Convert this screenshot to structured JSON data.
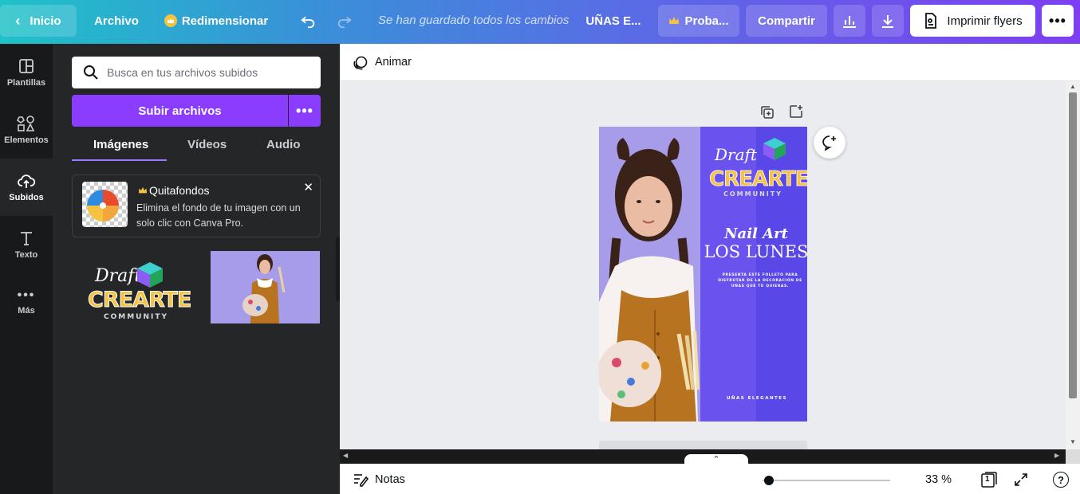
{
  "topbar": {
    "home_label": "Inicio",
    "file_label": "Archivo",
    "resize_label": "Redimensionar",
    "save_status": "Se han guardado todos los cambios",
    "doc_title": "UÑAS E...",
    "trial_label": "Proba...",
    "share_label": "Compartir",
    "print_label": "Imprimir flyers",
    "crown_color": "#f5c242"
  },
  "rail": {
    "items": [
      {
        "label": "Plantillas",
        "icon": "layout-icon"
      },
      {
        "label": "Elementos",
        "icon": "shapes-icon"
      },
      {
        "label": "Subidos",
        "icon": "cloud-upload-icon"
      },
      {
        "label": "Texto",
        "icon": "text-icon"
      },
      {
        "label": "Más",
        "icon": "more-dots-icon"
      }
    ]
  },
  "panel": {
    "search_placeholder": "Busca en tus archivos subidos",
    "upload_label": "Subir archivos",
    "tabs": [
      "Imágenes",
      "Vídeos",
      "Audio"
    ],
    "promo": {
      "title": "Quitafondos",
      "description": "Elimina el fondo de tu imagen con un solo clic con Canva Pro."
    },
    "logo": {
      "line1": "Draft",
      "line2": "CREARTE",
      "line3": "COMMUNITY"
    }
  },
  "canvas": {
    "animate_label": "Animar",
    "design": {
      "logo_line1": "Draft",
      "logo_line2": "CREARTE",
      "logo_line3": "COMMUNITY",
      "headline1": "Nail Art",
      "headline2": "LOS LUNES",
      "body": "PRESENTA ESTE FOLLETO PARA DISFRUTAR DE LA DECORACIÓN DE UÑAS QUE TÚ QUIERAS.",
      "footer": "UÑAS ELEGANTES"
    }
  },
  "bottombar": {
    "notes_label": "Notas",
    "zoom_label": "33 %",
    "zoom_percent": 33,
    "page_count": "1"
  },
  "colors": {
    "accent": "#8b3dff",
    "design_purple": "#5a47e8",
    "photo_bg": "#a79ce9"
  }
}
